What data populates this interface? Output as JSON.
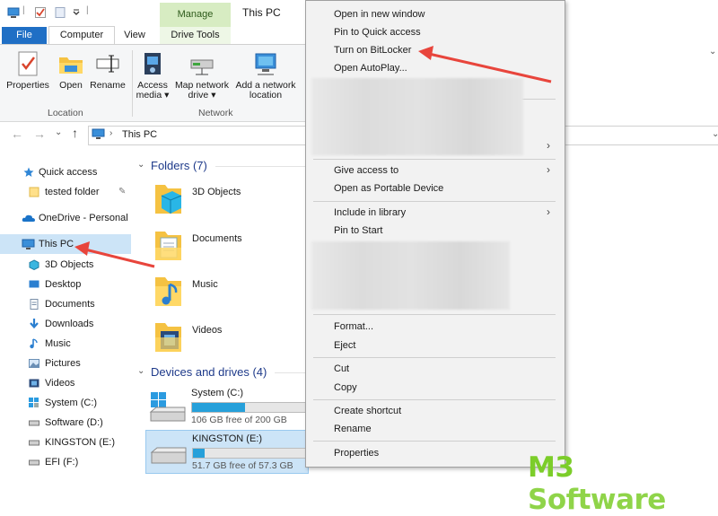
{
  "window": {
    "title": "This PC",
    "context_tab": "Manage"
  },
  "ribbon": {
    "tabs": [
      "File",
      "Computer",
      "View",
      "Drive Tools"
    ],
    "buttons": {
      "properties": "Properties",
      "open": "Open",
      "rename": "Rename",
      "access_media_1": "Access",
      "access_media_2": "media ▾",
      "map_drive_1": "Map network",
      "map_drive_2": "drive ▾",
      "add_location_1": "Add a network",
      "add_location_2": "location"
    },
    "groups": {
      "location": "Location",
      "network": "Network"
    }
  },
  "address": {
    "path": "This PC"
  },
  "nav": {
    "quick_access": "Quick access",
    "tested_folder": "tested folder",
    "onedrive": "OneDrive - Personal",
    "this_pc": "This PC",
    "objects3d": "3D Objects",
    "desktop": "Desktop",
    "documents": "Documents",
    "downloads": "Downloads",
    "music": "Music",
    "pictures": "Pictures",
    "videos": "Videos",
    "system_c": "System (C:)",
    "software_d": "Software (D:)",
    "kingston_e": "KINGSTON (E:)",
    "efi_f": "EFI (F:)"
  },
  "content": {
    "folders_header": "Folders (7)",
    "folders": [
      "3D Objects",
      "Documents",
      "Music",
      "Videos"
    ],
    "drives_header": "Devices and drives (4)",
    "drives": [
      {
        "name": "System (C:)",
        "free": "106 GB free of 200 GB",
        "used_fraction": 0.47
      },
      {
        "name": "KINGSTON (E:)",
        "free": "51.7 GB free of 57.3 GB",
        "used_fraction": 0.1
      }
    ]
  },
  "context_menu": {
    "open_new_window": "Open in new window",
    "pin_quick_access": "Pin to Quick access",
    "turn_on_bitlocker": "Turn on BitLocker",
    "open_autoplay": "Open AutoPlay...",
    "give_access": "Give access to",
    "open_portable": "Open as Portable Device",
    "include_library": "Include in library",
    "pin_start": "Pin to Start",
    "format": "Format...",
    "eject": "Eject",
    "cut": "Cut",
    "copy": "Copy",
    "create_shortcut": "Create shortcut",
    "rename": "Rename",
    "properties": "Properties"
  },
  "watermark": {
    "part1": "M3",
    "part2": " Software"
  },
  "colors": {
    "accent": "#1f6fc5",
    "selection": "#cce4f7",
    "drive_bar": "#26a0da",
    "arrow": "#e8453c",
    "manage_tab": "#d7ecc2",
    "watermark": "#7ccd2a"
  }
}
